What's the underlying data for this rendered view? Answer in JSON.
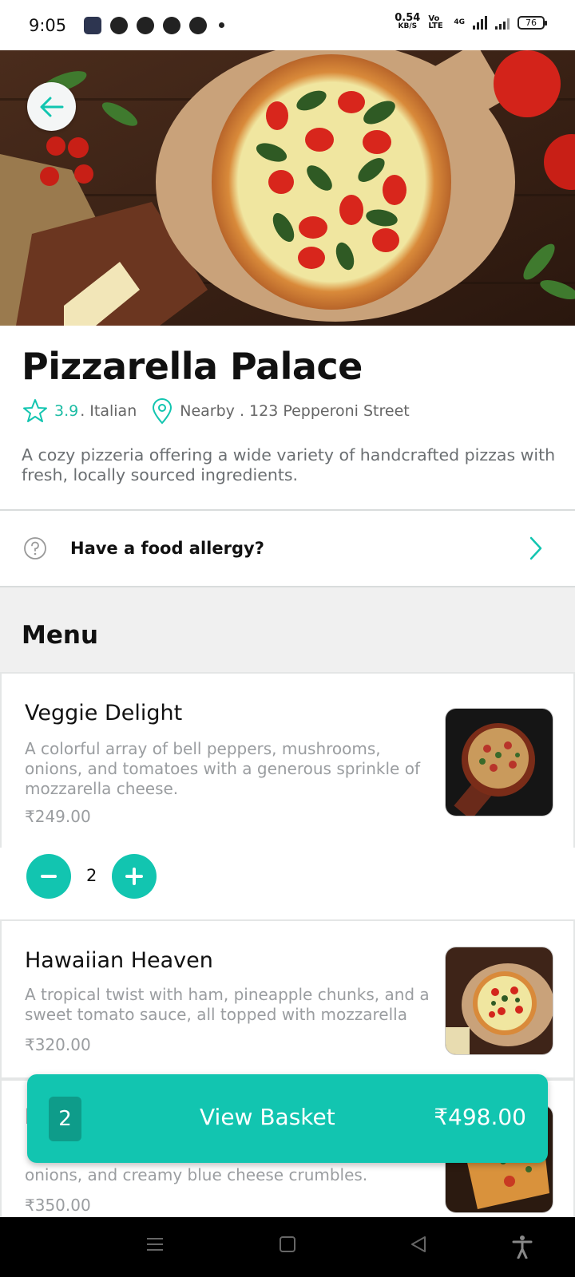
{
  "status_bar": {
    "time": "9:05",
    "net_speed_value": "0.54",
    "net_speed_unit": "KB/S",
    "volte_label": "Vo LTE",
    "network_label": "4G",
    "battery": "76",
    "app_icons": [
      "gallery-app-icon",
      "chat-app-icon",
      "pinterest-icon",
      "pinwheel-app-icon",
      "arc-app-icon"
    ]
  },
  "restaurant": {
    "name": "Pizzarella Palace",
    "rating": "3.9",
    "cuisine": ". Italian",
    "location": "Nearby . 123 Pepperoni Street",
    "description": "A cozy pizzeria offering a wide variety of handcrafted pizzas with fresh, locally sourced ingredients."
  },
  "allergy": {
    "label": "Have a food allergy?"
  },
  "menu": {
    "heading": "Menu",
    "items": [
      {
        "name": "Veggie Delight",
        "description": "A colorful array of bell peppers, mushrooms, onions, and tomatoes with a generous sprinkle of mozzarella cheese.",
        "price": "₹249.00",
        "quantity": "2"
      },
      {
        "name": "Hawaiian Heaven",
        "description": "A tropical twist with ham, pineapple chunks, and a sweet tomato sauce, all topped with mozzarella",
        "price": "₹320.00"
      },
      {
        "name": "B",
        "description": "onions, and creamy blue cheese crumbles.",
        "price": "₹350.00"
      }
    ]
  },
  "basket": {
    "count": "2",
    "label": "View Basket",
    "total": "₹498.00"
  },
  "colors": {
    "accent": "#12c5b0",
    "accent_dark": "#0e9c8a",
    "text_muted": "#9a9da0"
  }
}
